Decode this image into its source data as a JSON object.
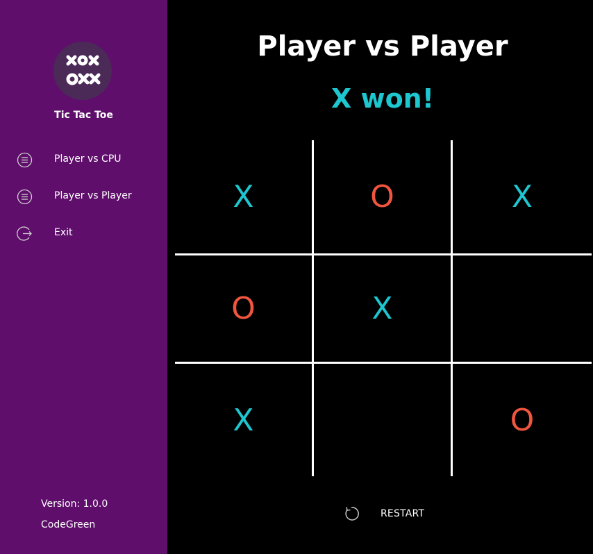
{
  "app": {
    "title": "Tic Tac Toe",
    "version": "Version: 1.0.0",
    "author": "CodeGreen"
  },
  "menu": [
    {
      "label": "Player vs CPU",
      "icon": "list-circle-icon"
    },
    {
      "label": "Player vs Player",
      "icon": "list-circle-icon"
    },
    {
      "label": "Exit",
      "icon": "exit-icon"
    }
  ],
  "game": {
    "mode_title": "Player vs Player",
    "status": "X won!",
    "board": [
      "X",
      "O",
      "X",
      "O",
      "X",
      "",
      "X",
      "",
      "O"
    ]
  },
  "controls": {
    "restart_label": "RESTART",
    "restart_icon": "refresh-icon"
  },
  "colors": {
    "sidebar": "#5f0f6b",
    "x_mark": "#1ec6cf",
    "o_mark": "#f0553f",
    "background": "#000000"
  }
}
